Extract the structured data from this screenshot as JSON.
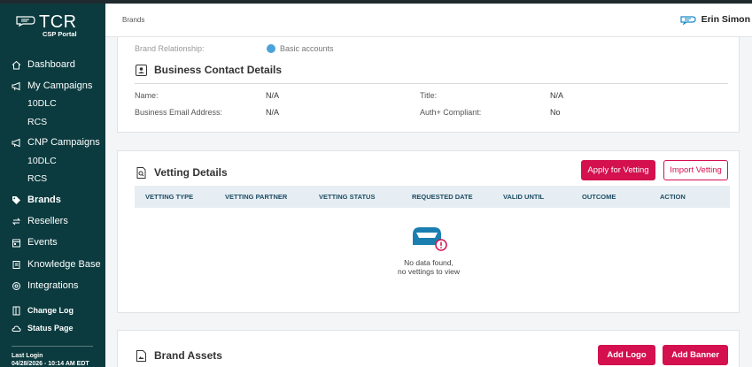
{
  "sidebar": {
    "logo_text": "TCR",
    "logo_sub": "CSP Portal",
    "items": [
      {
        "label": "Dashboard"
      },
      {
        "label": "My Campaigns"
      },
      {
        "label": "10DLC"
      },
      {
        "label": "RCS"
      },
      {
        "label": "CNP Campaigns"
      },
      {
        "label": "10DLC"
      },
      {
        "label": "RCS"
      },
      {
        "label": "Brands"
      },
      {
        "label": "Resellers"
      },
      {
        "label": "Events"
      },
      {
        "label": "Knowledge Base"
      },
      {
        "label": "Integrations"
      },
      {
        "label": "Change Log"
      },
      {
        "label": "Status Page"
      }
    ],
    "last_login_label": "Last Login",
    "last_login_value": "04/28/2026 - 10:14 AM EDT"
  },
  "header": {
    "breadcrumb": "Brands",
    "user_name": "Erin Simon"
  },
  "brand_relationship": {
    "label": "Brand Relationship:",
    "value": "Basic accounts"
  },
  "business_contact": {
    "title": "Business Contact Details",
    "fields": {
      "name_label": "Name:",
      "name_value": "N/A",
      "email_label": "Business Email Address:",
      "email_value": "N/A",
      "title_label": "Title:",
      "title_value": "N/A",
      "auth_label": "Auth+ Compliant:",
      "auth_value": "No"
    }
  },
  "vetting": {
    "title": "Vetting Details",
    "apply_button": "Apply for Vetting",
    "import_button": "Import Vetting",
    "columns": [
      "VETTING TYPE",
      "VETTING PARTNER",
      "VETTING STATUS",
      "REQUESTED DATE",
      "VALID UNTIL",
      "OUTCOME",
      "ACTION"
    ],
    "empty_line1": "No data found,",
    "empty_line2": "no vettings to view"
  },
  "brand_assets": {
    "title": "Brand Assets",
    "add_logo_button": "Add Logo",
    "add_banner_button": "Add Banner"
  },
  "colors": {
    "sidebar_bg": "#0b3b3f",
    "accent": "#d4104e",
    "table_header_bg": "#e6eef3",
    "table_header_text": "#1e4c64"
  }
}
